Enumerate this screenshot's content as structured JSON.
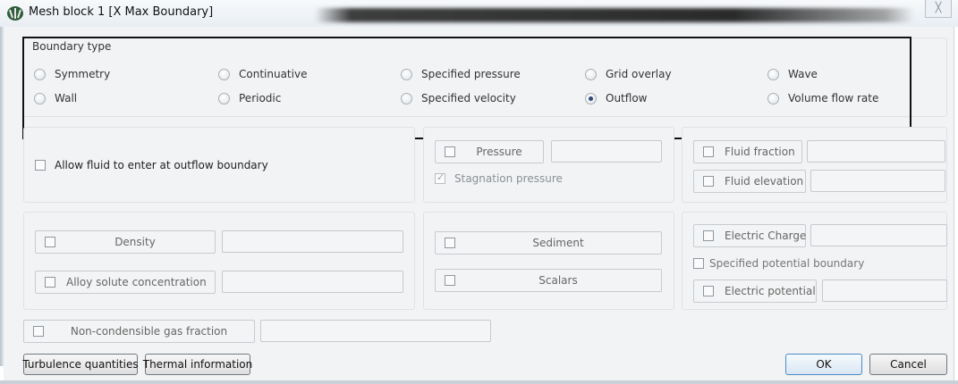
{
  "window": {
    "title": "Mesh block 1 [X Max Boundary]",
    "close_glyph": "╳"
  },
  "boundary_type": {
    "label": "Boundary type",
    "options": [
      {
        "label": "Symmetry",
        "checked": false
      },
      {
        "label": "Continuative",
        "checked": false
      },
      {
        "label": "Specified pressure",
        "checked": false
      },
      {
        "label": "Grid overlay",
        "checked": false
      },
      {
        "label": "Wave",
        "checked": false
      },
      {
        "label": "Wall",
        "checked": false
      },
      {
        "label": "Periodic",
        "checked": false
      },
      {
        "label": "Specified velocity",
        "checked": false
      },
      {
        "label": "Outflow",
        "checked": true
      },
      {
        "label": "Volume flow rate",
        "checked": false
      }
    ]
  },
  "outflow": {
    "allow_fluid_label": "Allow fluid to enter at outflow boundary"
  },
  "pressure_group": {
    "pressure_label": "Pressure",
    "pressure_value": "",
    "stagnation_label": "Stagnation pressure",
    "stagnation_checked": true
  },
  "fluid_group": {
    "fraction_label": "Fluid fraction",
    "fraction_value": "",
    "elevation_label": "Fluid elevation",
    "elevation_value": ""
  },
  "species_group": {
    "density_label": "Density",
    "density_value": "",
    "alloy_label": "Alloy solute concentration",
    "alloy_value": ""
  },
  "sediment_group": {
    "sediment_label": "Sediment",
    "scalars_label": "Scalars"
  },
  "electric_group": {
    "charge_label": "Electric Charge",
    "charge_value": "",
    "specified_potential_label": "Specified potential boundary",
    "potential_label": "Electric potential",
    "potential_value": ""
  },
  "gas": {
    "label": "Non-condensible gas fraction",
    "value": ""
  },
  "buttons": {
    "turbulence": "Turbulence quantities",
    "thermal": "Thermal information",
    "ok": "OK",
    "cancel": "Cancel"
  },
  "icons": {
    "app": "app-logo-icon",
    "close": "close-icon"
  }
}
